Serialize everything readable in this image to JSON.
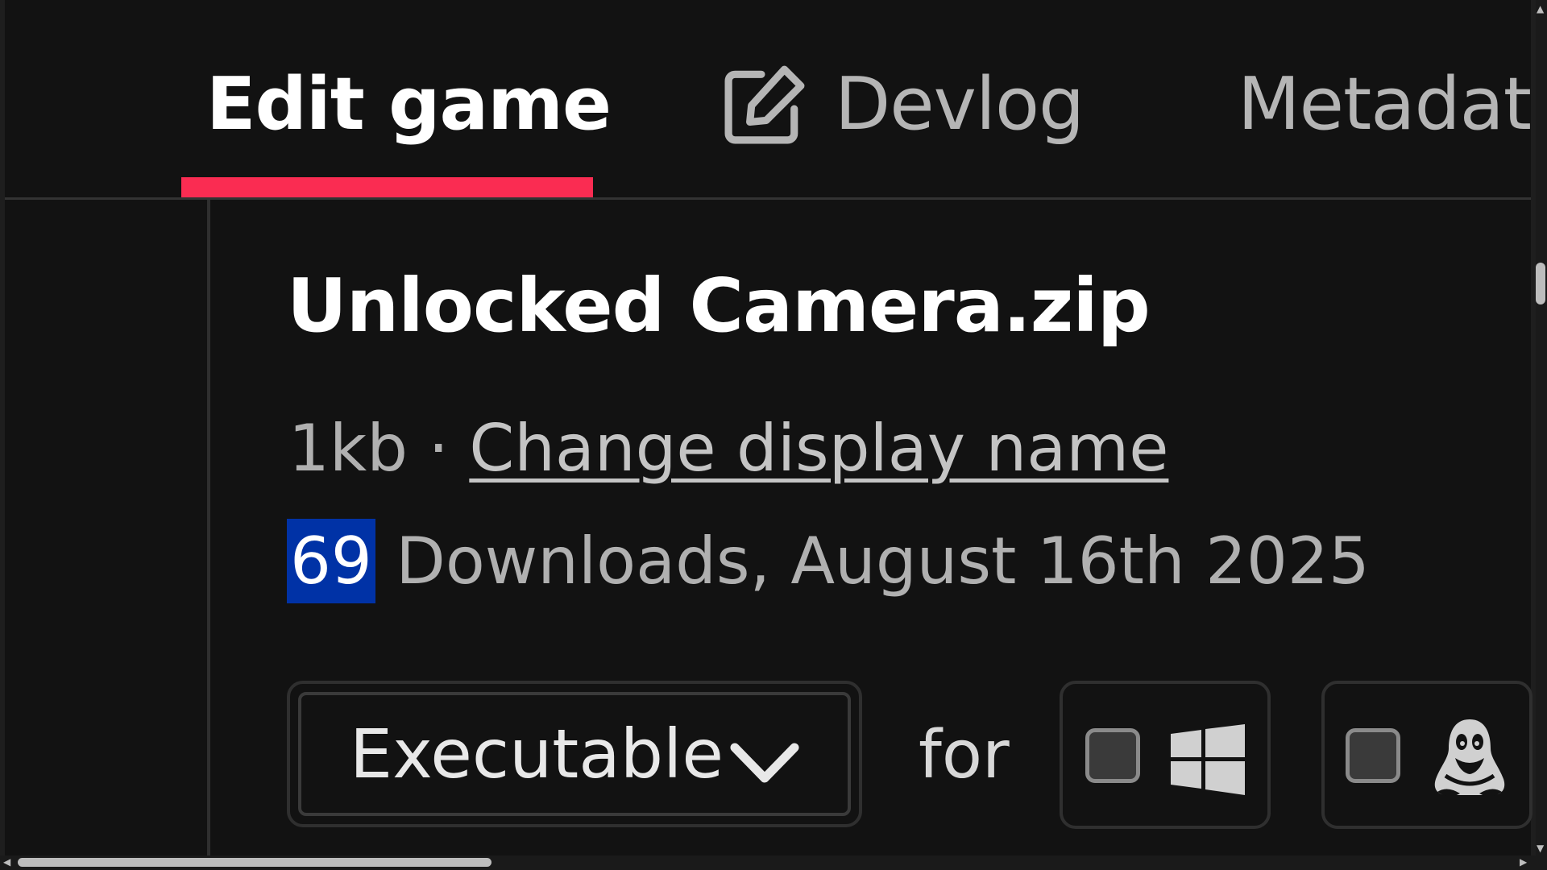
{
  "tabs": [
    {
      "label": "Edit game",
      "active": true
    },
    {
      "label": "Devlog",
      "icon": "pencil-square-icon"
    },
    {
      "label": "Metadat"
    }
  ],
  "upload": {
    "filename": "Unlocked Camera.zip",
    "size": "1kb",
    "separator": "·",
    "change_name_link": "Change display name",
    "download_count": "69",
    "downloads_suffix": "Downloads, August 16th 2025"
  },
  "controls": {
    "type_select": "Executable",
    "for_label": "for",
    "platforms": [
      {
        "name": "windows",
        "icon": "windows-icon",
        "checked": false
      },
      {
        "name": "linux",
        "icon": "linux-tux-icon",
        "checked": false
      }
    ]
  },
  "colors": {
    "accent": "#fa2c52",
    "selection": "#0032a6",
    "background": "#121212"
  }
}
